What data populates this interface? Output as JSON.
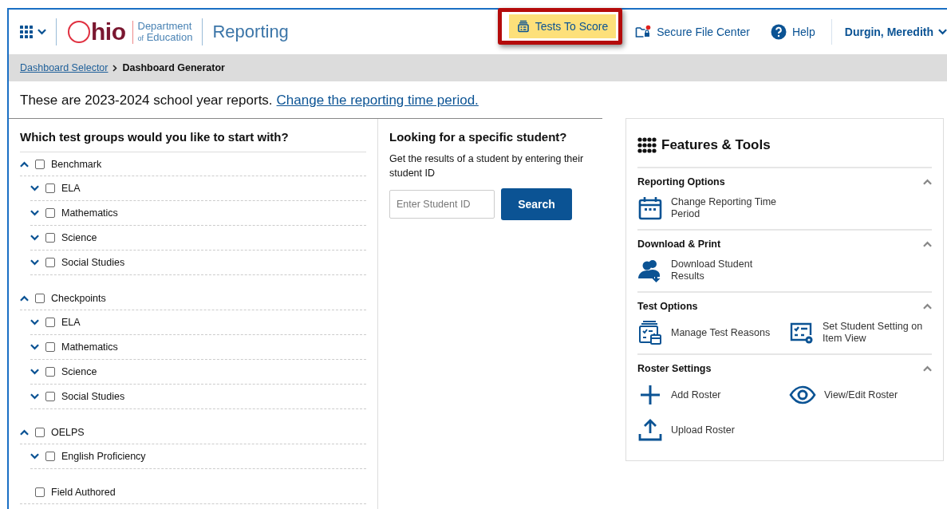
{
  "header": {
    "logo_word": "hio",
    "logo_dept_top": "Department",
    "logo_dept_of": "of",
    "logo_dept_bottom": "Education",
    "app_title": "Reporting",
    "actions": [
      {
        "kind": "tests",
        "label": "Tests To Score",
        "highlighted": true
      },
      {
        "kind": "files",
        "label": "Secure File Center",
        "highlighted": false
      },
      {
        "kind": "help",
        "label": "Help",
        "highlighted": false
      }
    ],
    "user": "Durgin, Meredith"
  },
  "breadcrumb": {
    "link": "Dashboard Selector",
    "current": "Dashboard Generator"
  },
  "notice": {
    "text": "These are 2023-2024 school year reports.",
    "link": "Change the reporting time period."
  },
  "test_groups": {
    "title": "Which test groups would you like to start with?",
    "groups": [
      {
        "label": "Benchmark",
        "expanded": true,
        "checked": false,
        "children": [
          {
            "label": "ELA",
            "expanded": false,
            "checked": false
          },
          {
            "label": "Mathematics",
            "expanded": false,
            "checked": false
          },
          {
            "label": "Science",
            "expanded": false,
            "checked": false
          },
          {
            "label": "Social Studies",
            "expanded": false,
            "checked": false
          }
        ]
      },
      {
        "label": "Checkpoints",
        "expanded": true,
        "checked": false,
        "children": [
          {
            "label": "ELA",
            "expanded": false,
            "checked": false
          },
          {
            "label": "Mathematics",
            "expanded": false,
            "checked": false
          },
          {
            "label": "Science",
            "expanded": false,
            "checked": false
          },
          {
            "label": "Social Studies",
            "expanded": false,
            "checked": false
          }
        ]
      },
      {
        "label": "OELPS",
        "expanded": true,
        "checked": false,
        "children": [
          {
            "label": "English Proficiency",
            "expanded": false,
            "checked": false
          }
        ]
      },
      {
        "label": "Field Authored",
        "checked": false
      }
    ]
  },
  "student_search": {
    "title": "Looking for a specific student?",
    "description": "Get the results of a student by entering their student ID",
    "placeholder": "Enter Student ID",
    "button": "Search"
  },
  "features": {
    "title": "Features & Tools",
    "sections": [
      {
        "title": "Reporting Options",
        "expanded": true,
        "items": [
          {
            "kind": "calendar",
            "label": "Change Reporting Time Period"
          }
        ]
      },
      {
        "title": "Download & Print",
        "expanded": true,
        "items": [
          {
            "kind": "people-download",
            "label": "Download Student Results"
          }
        ]
      },
      {
        "title": "Test Options",
        "expanded": true,
        "items": [
          {
            "kind": "stack",
            "label": "Manage Test Reasons"
          },
          {
            "kind": "list-gear",
            "label": "Set Student Setting on Item View"
          }
        ]
      },
      {
        "title": "Roster Settings",
        "expanded": true,
        "items": [
          {
            "kind": "plus",
            "label": "Add Roster"
          },
          {
            "kind": "eye",
            "label": "View/Edit Roster"
          },
          {
            "kind": "upload",
            "label": "Upload Roster"
          }
        ]
      }
    ]
  }
}
